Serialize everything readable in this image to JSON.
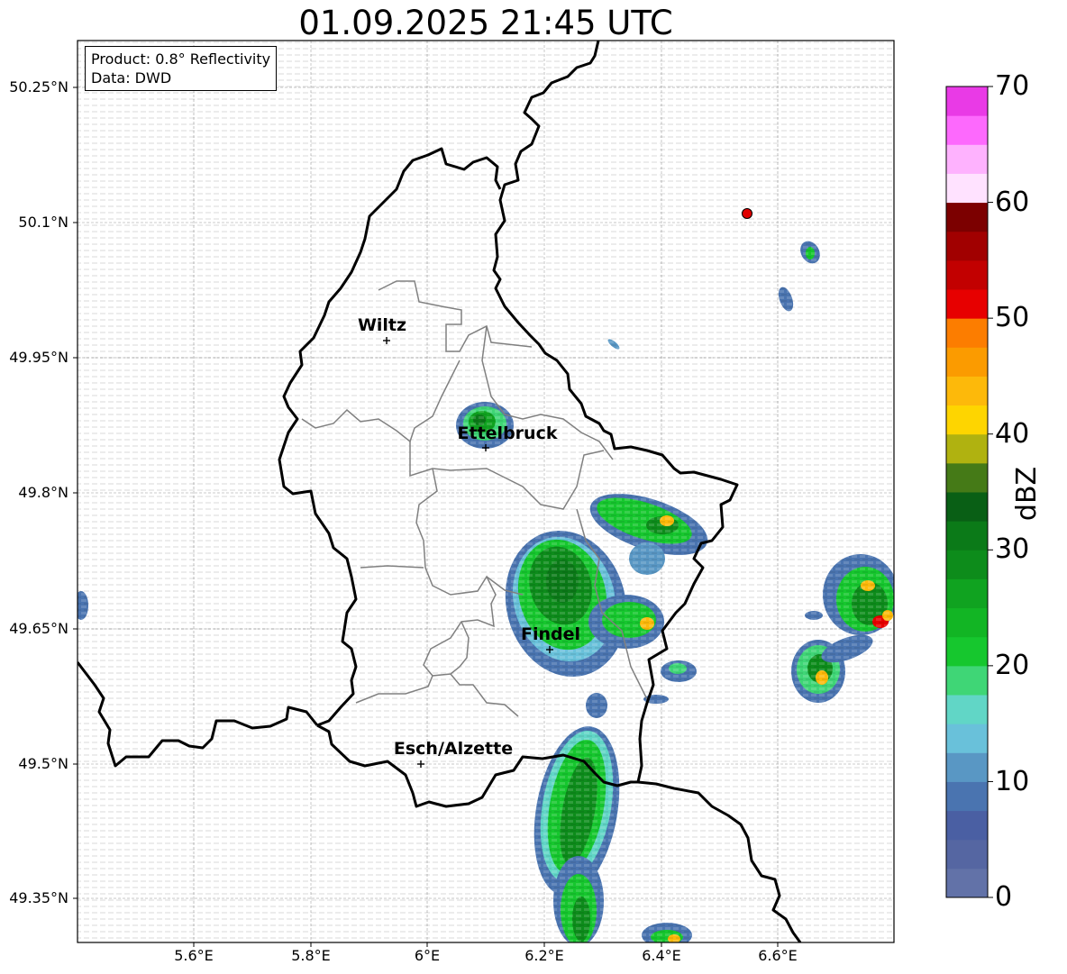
{
  "title": "01.09.2025 21:45 UTC",
  "info_box": {
    "product": "Product: 0.8° Reflectivity",
    "data_source": "Data: DWD"
  },
  "latitude_ticks": [
    "50.25°N",
    "50.1°N",
    "49.95°N",
    "49.8°N",
    "49.65°N",
    "49.5°N",
    "49.35°N"
  ],
  "longitude_ticks": [
    "5.6°E",
    "5.8°E",
    "6°E",
    "6.2°E",
    "6.4°E",
    "6.6°E"
  ],
  "cities": [
    {
      "name": "Wiltz"
    },
    {
      "name": "Ettelbruck"
    },
    {
      "name": "Findel"
    },
    {
      "name": "Esch/Alzette"
    }
  ],
  "colorbar": {
    "label": "dBZ",
    "ticks": [
      "70",
      "60",
      "50",
      "40",
      "30",
      "20",
      "10",
      "0"
    ],
    "range": [
      0,
      70
    ],
    "step": 2.5,
    "colors": [
      "#6272a8",
      "#5566a2",
      "#4a5fa3",
      "#4a74b0",
      "#5997c4",
      "#69c1da",
      "#61d6c6",
      "#3fd676",
      "#16c72e",
      "#12b524",
      "#10a320",
      "#0d8c1b",
      "#0b7a18",
      "#095f15",
      "#457a17",
      "#b0b210",
      "#fed500",
      "#fdb90a",
      "#fb9b00",
      "#fc7d00",
      "#e70000",
      "#c20000",
      "#a10000",
      "#7c0000",
      "#ffe2ff",
      "#feb2fe",
      "#fd69fd",
      "#e93ae6"
    ]
  },
  "radar_site_color": "#e00000"
}
